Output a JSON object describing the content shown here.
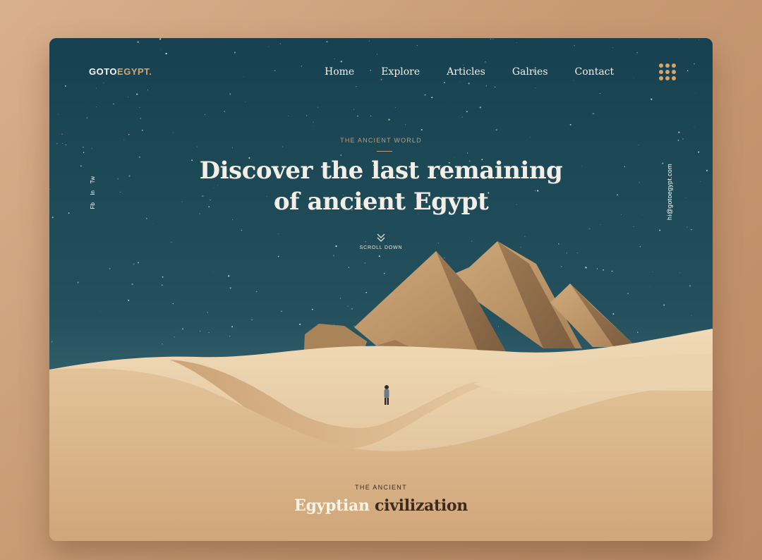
{
  "brand": {
    "logo_part1": "GOTO",
    "logo_part2": "EGYPT.",
    "accent_color": "#d7a46a"
  },
  "nav": {
    "items": [
      {
        "label": "Home"
      },
      {
        "label": "Explore"
      },
      {
        "label": "Articles"
      },
      {
        "label": "Galries"
      },
      {
        "label": "Contact"
      }
    ],
    "menu_icon": "grid-dots-icon"
  },
  "social": {
    "items": [
      {
        "label": "Fb"
      },
      {
        "label": "In"
      },
      {
        "label": "Tw"
      }
    ]
  },
  "contact": {
    "email": "hi@gotoegypt.com"
  },
  "hero": {
    "kicker": "THE ANCIENT WORLD",
    "headline_line1": "Discover the last remaining",
    "headline_line2": "of ancient Egypt",
    "scroll_label": "SCROLL DOWN",
    "scroll_icon": "chevron-double-down-icon"
  },
  "section": {
    "kicker": "THE ANCIENT",
    "title_light": "Egyptian",
    "title_dark": "civilization"
  },
  "colors": {
    "sky_top": "#1b4450",
    "sky_bottom": "#2f5a66",
    "sand_light": "#ead2ac",
    "sand_dark": "#c89a6c",
    "page_background": "#c99c76"
  }
}
